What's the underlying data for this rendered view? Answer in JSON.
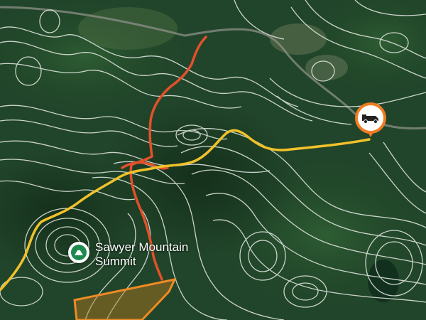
{
  "map": {
    "type": "topographic satellite",
    "colors": {
      "contour": "#e8ece6",
      "trail_yellow": "#f1c12a",
      "trail_red": "#e4502a",
      "boundary_orange": "#f08a24",
      "road": "#8c9088",
      "pin_orange": "#f07c22"
    }
  },
  "poi": {
    "summit_name": "Sawyer Mountain Summit",
    "summit_icon": "summit-flag-icon"
  },
  "markers": {
    "trailhead_icon": "truck-icon"
  }
}
